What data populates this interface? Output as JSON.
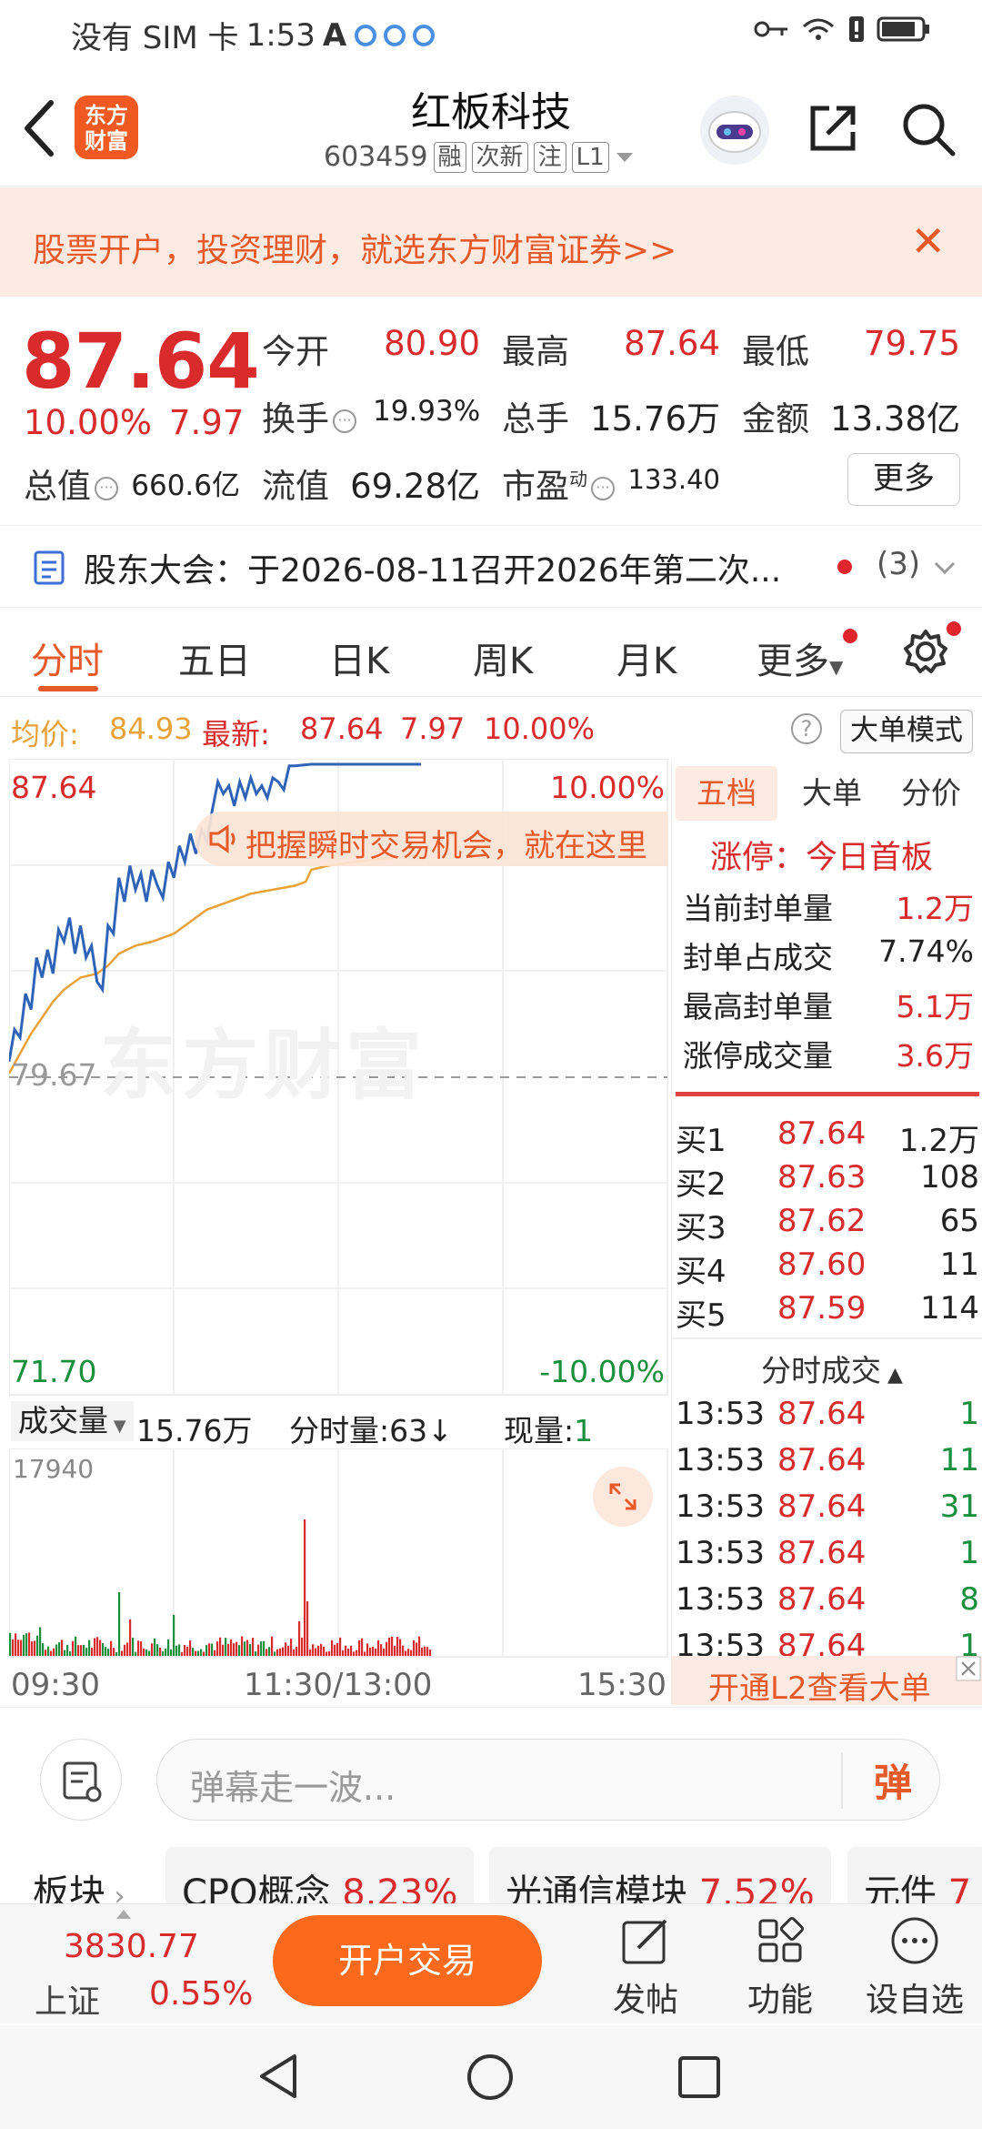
{
  "status_bar": {
    "carrier": "没有 SIM 卡",
    "time": "1:53",
    "a_glyph": "A"
  },
  "header": {
    "logo_line1": "东方",
    "logo_line2": "财富",
    "title": "红板科技",
    "code": "603459",
    "tags": [
      "融",
      "次新",
      "注",
      "L1"
    ]
  },
  "banner": {
    "text": "股票开户，投资理财，就选东方财富证券>>",
    "close": "✕"
  },
  "quote": {
    "price": "87.64",
    "change_pct": "10.00%",
    "change": "7.97",
    "open_label": "今开",
    "open": "80.90",
    "high_label": "最高",
    "high": "87.64",
    "low_label": "最低",
    "low": "79.75",
    "turnover_label": "换手",
    "turnover": "19.93%",
    "volume_label": "总手",
    "volume": "15.76万",
    "amount_label": "金额",
    "amount": "13.38亿",
    "mcap_label": "总值",
    "mcap": "660.6亿",
    "float_label": "流值",
    "float": "69.28亿",
    "pe_label": "市盈",
    "pe_sup": "动",
    "pe": "133.40",
    "more": "更多"
  },
  "notice": {
    "text": "股东大会：于2026-08-11召开2026年第二次...",
    "count": "(3)"
  },
  "tabs": [
    "分时",
    "五日",
    "日K",
    "周K",
    "月K",
    "更多"
  ],
  "info_row": {
    "avg_label": "均价:",
    "avg": "84.93",
    "last_label": "最新:",
    "last": "87.64",
    "chg": "7.97",
    "pct": "10.00%",
    "help": "?",
    "mode_btn": "大单模式"
  },
  "chart": {
    "price_top": "87.64",
    "pct_top": "10.00%",
    "price_mid": "79.67",
    "price_bottom": "71.70",
    "pct_bottom": "-10.00%",
    "watermark": "东方财富",
    "toast": "把握瞬时交易机会，就在这里"
  },
  "volume": {
    "selector": "成交量",
    "total": "15.76万",
    "minute_label": "分时量:63↓",
    "now_label": "现量:",
    "now": "1",
    "ymax": "17940"
  },
  "time_axis": [
    "09:30",
    "11:30/13:00",
    "15:30"
  ],
  "chart_data": {
    "type": "line",
    "series": [],
    "ylim": [
      71.7,
      87.64
    ],
    "xlim": [
      0,
      240
    ],
    "price_points": [
      [
        0,
        80.2
      ],
      [
        2,
        81.0
      ],
      [
        4,
        80.8
      ],
      [
        6,
        81.9
      ],
      [
        8,
        81.5
      ],
      [
        10,
        82.8
      ],
      [
        12,
        82.3
      ],
      [
        14,
        83.0
      ],
      [
        16,
        82.4
      ],
      [
        18,
        83.5
      ],
      [
        20,
        83.2
      ],
      [
        22,
        83.8
      ],
      [
        24,
        82.9
      ],
      [
        26,
        83.6
      ],
      [
        28,
        82.8
      ],
      [
        30,
        83.1
      ],
      [
        32,
        82.2
      ],
      [
        34,
        82.0
      ],
      [
        36,
        83.6
      ],
      [
        38,
        83.4
      ],
      [
        40,
        84.8
      ],
      [
        42,
        84.2
      ],
      [
        44,
        85.1
      ],
      [
        46,
        84.5
      ],
      [
        48,
        84.9
      ],
      [
        50,
        84.2
      ],
      [
        52,
        85.0
      ],
      [
        54,
        84.6
      ],
      [
        56,
        84.3
      ],
      [
        58,
        85.2
      ],
      [
        60,
        84.8
      ],
      [
        62,
        85.6
      ],
      [
        64,
        85.2
      ],
      [
        66,
        85.9
      ],
      [
        68,
        85.4
      ],
      [
        70,
        86.0
      ],
      [
        72,
        85.7
      ],
      [
        74,
        86.5
      ],
      [
        76,
        87.2
      ],
      [
        78,
        86.9
      ],
      [
        80,
        87.1
      ],
      [
        82,
        86.6
      ],
      [
        84,
        87.2
      ],
      [
        86,
        86.8
      ],
      [
        88,
        87.3
      ],
      [
        90,
        86.9
      ],
      [
        92,
        87.1
      ],
      [
        94,
        86.8
      ],
      [
        96,
        87.3
      ],
      [
        98,
        87.2
      ],
      [
        100,
        87.0
      ],
      [
        102,
        87.6
      ],
      [
        104,
        87.6
      ],
      [
        110,
        87.64
      ],
      [
        130,
        87.64
      ],
      [
        140,
        87.64
      ],
      [
        150,
        87.64
      ]
    ],
    "avg_points": [
      [
        0,
        79.9
      ],
      [
        4,
        80.4
      ],
      [
        8,
        80.9
      ],
      [
        12,
        81.3
      ],
      [
        16,
        81.7
      ],
      [
        20,
        82.0
      ],
      [
        26,
        82.3
      ],
      [
        32,
        82.4
      ],
      [
        36,
        82.6
      ],
      [
        40,
        82.9
      ],
      [
        46,
        83.1
      ],
      [
        52,
        83.2
      ],
      [
        60,
        83.4
      ],
      [
        66,
        83.7
      ],
      [
        72,
        84.0
      ],
      [
        80,
        84.2
      ],
      [
        88,
        84.4
      ],
      [
        96,
        84.5
      ],
      [
        104,
        84.6
      ],
      [
        108,
        84.7
      ],
      [
        110,
        85.0
      ],
      [
        116,
        85.1
      ],
      [
        126,
        85.2
      ],
      [
        140,
        85.3
      ],
      [
        150,
        85.35
      ]
    ]
  },
  "right_panel": {
    "tabs": [
      "五档",
      "大单",
      "分价"
    ],
    "limit": "涨停：今日首板",
    "stats": [
      {
        "label": "当前封单量",
        "value": "1.2万"
      },
      {
        "label": "封单占成交",
        "value": "7.74%"
      },
      {
        "label": "最高封单量",
        "value": "5.1万"
      },
      {
        "label": "涨停成交量",
        "value": "3.6万"
      }
    ],
    "bids": [
      {
        "label": "买1",
        "price": "87.64",
        "qty": "1.2万"
      },
      {
        "label": "买2",
        "price": "87.63",
        "qty": "108"
      },
      {
        "label": "买3",
        "price": "87.62",
        "qty": "65"
      },
      {
        "label": "买4",
        "price": "87.60",
        "qty": "11"
      },
      {
        "label": "买5",
        "price": "87.59",
        "qty": "114"
      }
    ],
    "ticks_title": "分时成交",
    "ticks": [
      {
        "time": "13:53",
        "price": "87.64",
        "qty": "1"
      },
      {
        "time": "13:53",
        "price": "87.64",
        "qty": "11"
      },
      {
        "time": "13:53",
        "price": "87.64",
        "qty": "31"
      },
      {
        "time": "13:53",
        "price": "87.64",
        "qty": "1"
      },
      {
        "time": "13:53",
        "price": "87.64",
        "qty": "8"
      },
      {
        "time": "13:53",
        "price": "87.64",
        "qty": "1"
      }
    ],
    "l2_banner": "开通L2查看大单"
  },
  "danmu": {
    "placeholder": "弹幕走一波...",
    "send": "弹"
  },
  "sectors": {
    "label": "板块",
    "items": [
      {
        "name": "CPO概念",
        "pct": "8.23%"
      },
      {
        "name": "光通信模块",
        "pct": "7.52%"
      },
      {
        "name": "元件",
        "pct": "7"
      }
    ]
  },
  "bottom": {
    "index_value": "3830.77",
    "index_name": "上证",
    "index_pct": "0.55%",
    "trade": "开户交易",
    "post": "发帖",
    "func": "功能",
    "watch": "设自选"
  },
  "colors": {
    "up": "#d92b2b",
    "down": "#1a8f3c",
    "accent": "#e65a2a",
    "price_line": "#2e63b8",
    "avg_line": "#e8a23a"
  }
}
